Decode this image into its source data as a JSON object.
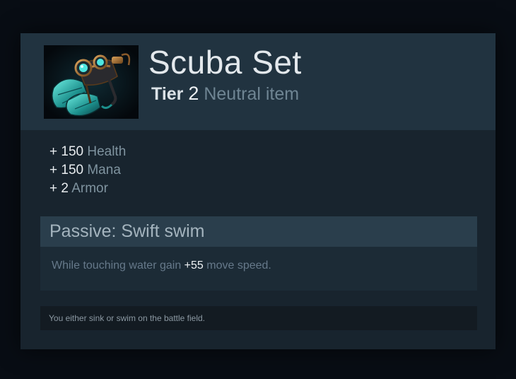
{
  "item": {
    "name": "Scuba Set",
    "tier_label": "Tier",
    "tier_number": "2",
    "item_type": "Neutral item",
    "icon": "scuba-gear-icon"
  },
  "stats": [
    {
      "value": "+ 150",
      "name": "Health"
    },
    {
      "value": "+ 150",
      "name": "Mana"
    },
    {
      "value": "+ 2",
      "name": "Armor"
    }
  ],
  "ability": {
    "title": "Passive: Swift swim",
    "description_before": "While touching water gain ",
    "description_highlight": "+55",
    "description_after": " move speed."
  },
  "lore": "You either sink or swim on the battle field.",
  "colors": {
    "page_background": "#080d14",
    "tooltip_background": "#18242e",
    "header_background": "#213340",
    "ability_header_background": "#2a3e4c",
    "lore_background": "#131b22",
    "accent_teal": "#3cc8c0"
  }
}
